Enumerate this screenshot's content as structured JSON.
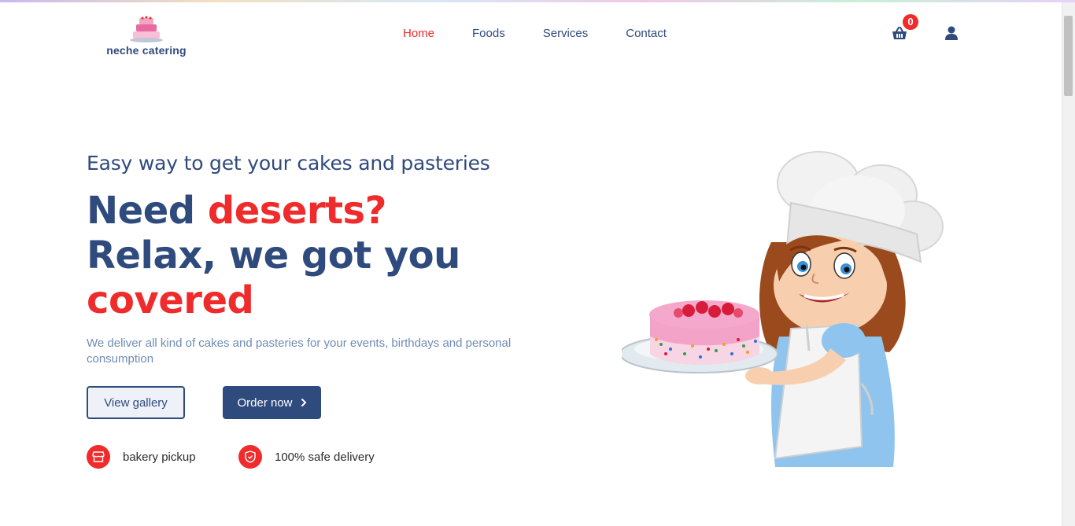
{
  "brand": {
    "name": "neche catering"
  },
  "nav": {
    "items": [
      {
        "label": "Home",
        "active": true
      },
      {
        "label": "Foods"
      },
      {
        "label": "Services"
      },
      {
        "label": "Contact"
      }
    ]
  },
  "header": {
    "cart_count": "0",
    "cart_icon": "basket-icon",
    "user_icon": "user-icon"
  },
  "hero": {
    "tagline": "Easy way to get your cakes and pasteries",
    "headline": {
      "part1": "Need ",
      "part2": "deserts?",
      "part3": "Relax, we got you",
      "part4": "covered"
    },
    "description": "We deliver all kind of cakes and pasteries for your events, birthdays and personal consumption",
    "buttons": {
      "gallery": "View gallery",
      "order": "Order now"
    },
    "features": [
      {
        "label": "bakery pickup",
        "icon": "store-icon"
      },
      {
        "label": "100% safe delivery",
        "icon": "shield-icon"
      }
    ]
  },
  "colors": {
    "primary": "#2f4a7d",
    "accent": "#ef2b2b",
    "muted": "#6e8cb6"
  }
}
